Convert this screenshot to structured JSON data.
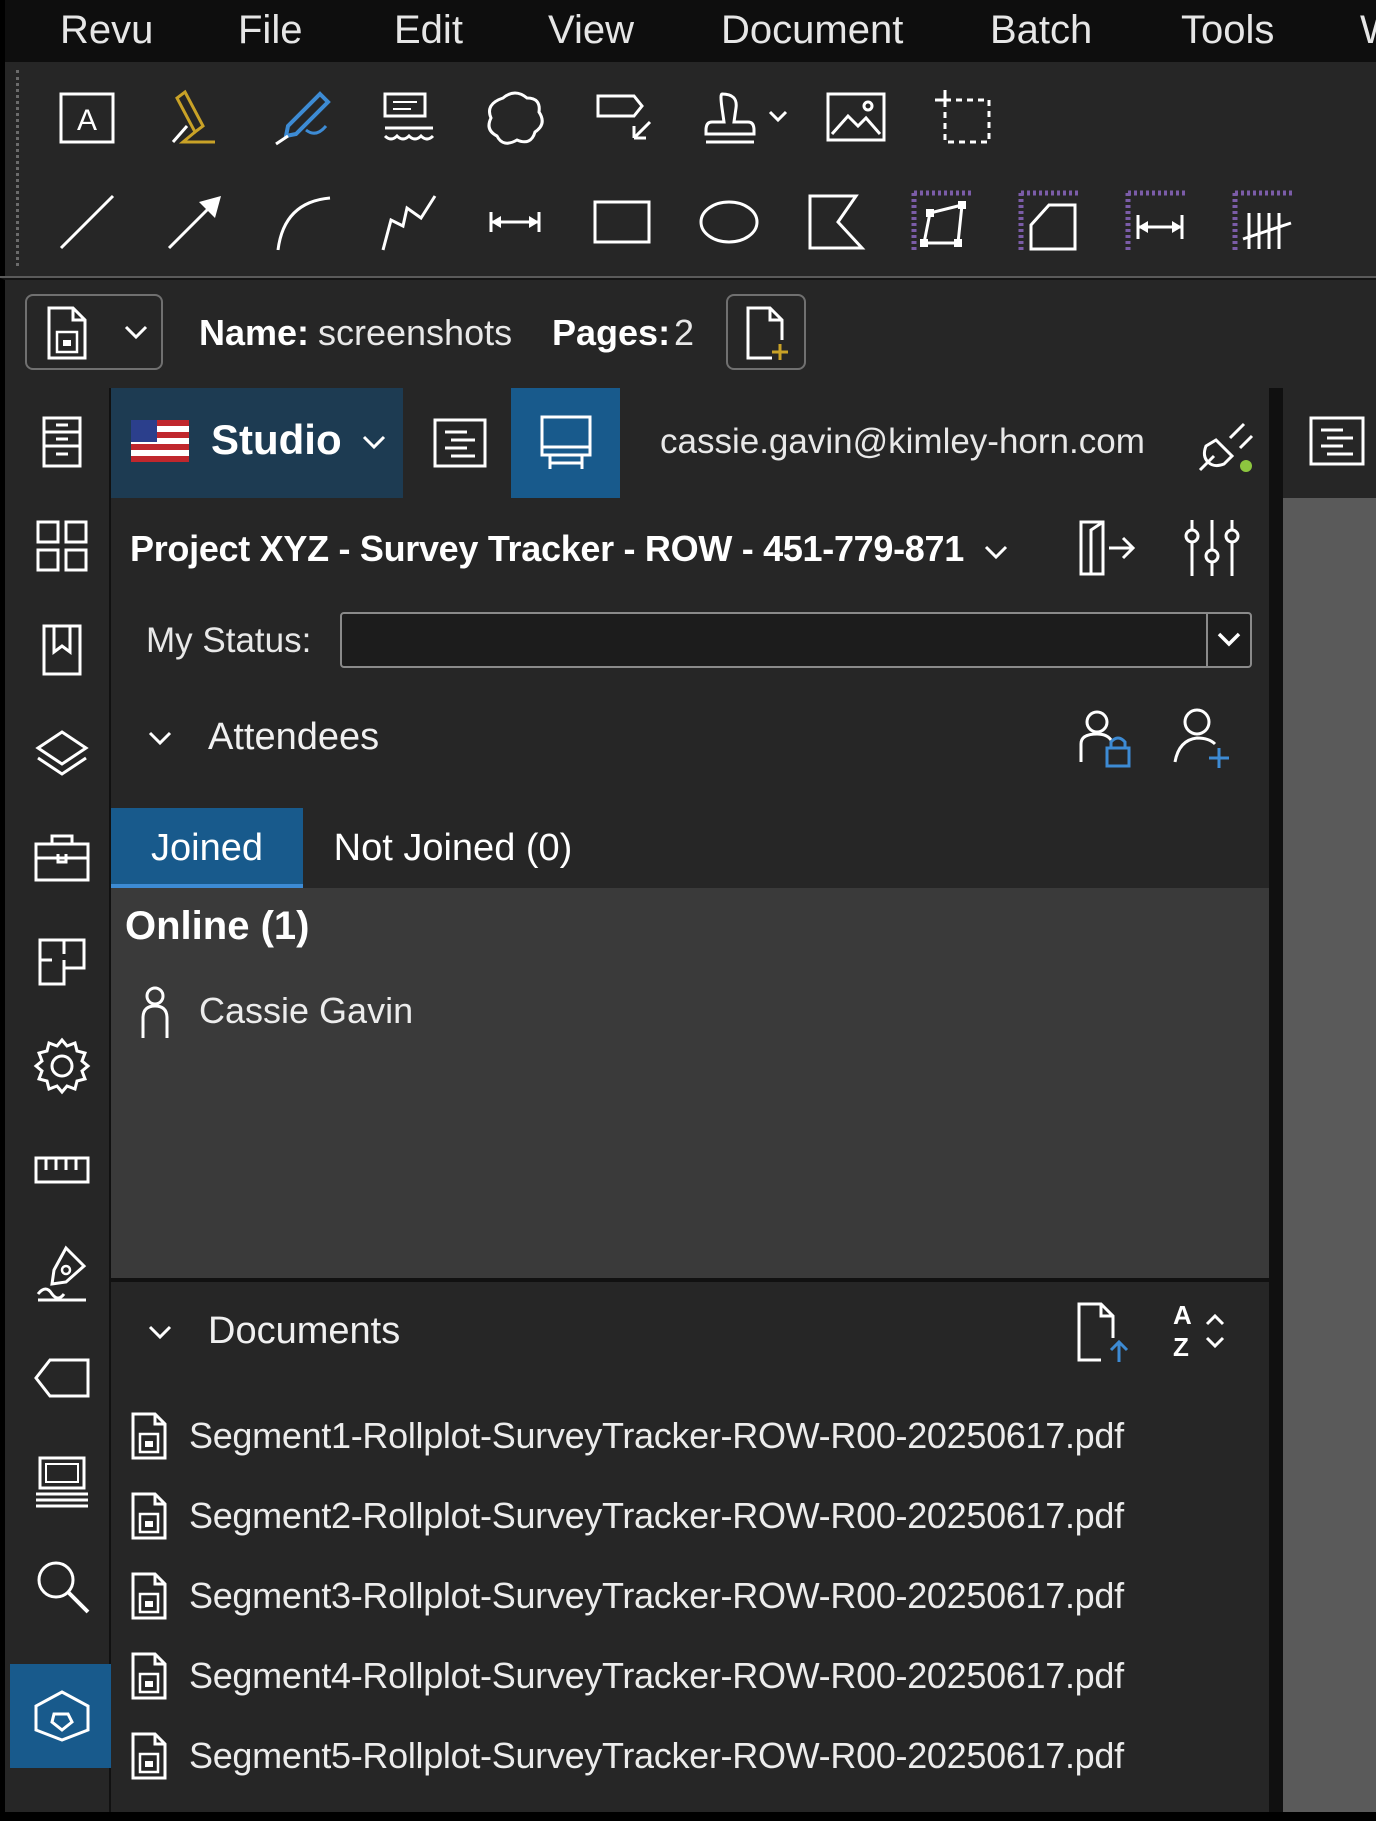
{
  "menu": [
    "Revu",
    "File",
    "Edit",
    "View",
    "Document",
    "Batch",
    "Tools",
    "W"
  ],
  "toolbar": {
    "row1": [
      "text-box-icon",
      "highlight-icon",
      "pen-icon",
      "callout-icon",
      "cloud-icon",
      "note-icon",
      "stamp-icon",
      "image-icon",
      "snapshot-icon"
    ],
    "row2": [
      "line-icon",
      "arrow-icon",
      "arc-icon",
      "polyline-icon",
      "dimension-icon",
      "rectangle-icon",
      "ellipse-icon",
      "polygon-icon",
      "measure-area-icon",
      "measure-polygon-icon",
      "measure-length-icon",
      "count-icon"
    ]
  },
  "document": {
    "name_label": "Name:",
    "name_value": "screenshots",
    "pages_label": "Pages:",
    "pages_value": "2"
  },
  "studio": {
    "label": "Studio",
    "user_email": "cassie.gavin@kimley-horn.com"
  },
  "session": {
    "title": "Project XYZ - Survey Tracker - ROW - 451-779-871",
    "status_label": "My Status:",
    "status_value": ""
  },
  "attendees": {
    "title": "Attendees",
    "tabs": [
      "Joined",
      "Not Joined (0)"
    ],
    "active_tab": "Joined",
    "online_heading": "Online (1)",
    "members": [
      "Cassie Gavin"
    ]
  },
  "documents": {
    "title": "Documents",
    "files": [
      "Segment1-Rollplot-SurveyTracker-ROW-R00-20250617.pdf",
      "Segment2-Rollplot-SurveyTracker-ROW-R00-20250617.pdf",
      "Segment3-Rollplot-SurveyTracker-ROW-R00-20250617.pdf",
      "Segment4-Rollplot-SurveyTracker-ROW-R00-20250617.pdf",
      "Segment5-Rollplot-SurveyTracker-ROW-R00-20250617.pdf"
    ]
  },
  "colors": {
    "accent": "#185a8c",
    "panel_bg": "#262626",
    "list_bg": "#3a3a3a",
    "menubar_bg": "#0e0e0e",
    "online_dot": "#8dc63f",
    "icon_blue": "#3d8bd4",
    "measure_purple": "#7b5ca8",
    "highlight_yellow": "#c9a227"
  }
}
